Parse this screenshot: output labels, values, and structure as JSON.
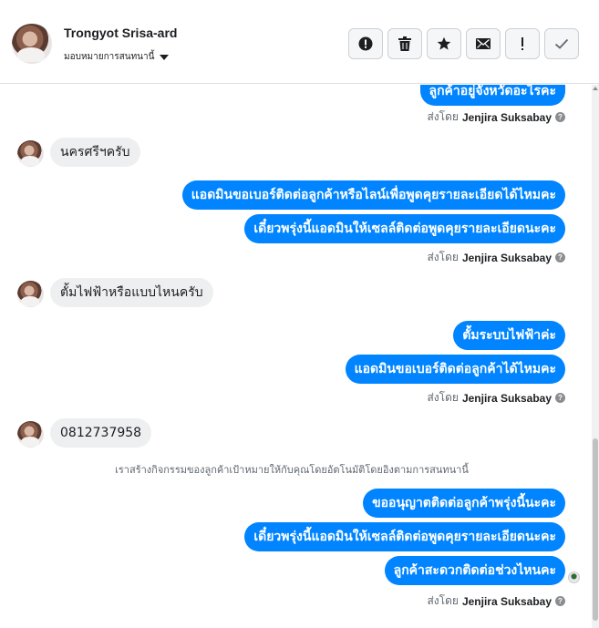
{
  "header": {
    "contact_name": "Trongyot Srisa-ard",
    "assign_label": "มอบหมายการสนทนานี้",
    "actions": [
      {
        "name": "spam-button",
        "icon": "alert-circle-icon"
      },
      {
        "name": "delete-button",
        "icon": "trash-icon"
      },
      {
        "name": "star-button",
        "icon": "star-icon"
      },
      {
        "name": "mark-unread-button",
        "icon": "envelope-icon"
      },
      {
        "name": "follow-up-button",
        "icon": "exclamation-icon"
      },
      {
        "name": "mark-done-button",
        "icon": "check-icon"
      }
    ]
  },
  "thread": {
    "messages": [
      {
        "dir": "out",
        "text": "ลูกค้าอยู่จังหวัดอะไรคะ"
      },
      {
        "dir": "sent_by",
        "prefix": "ส่งโดย",
        "agent": "Jenjira Suksabay"
      },
      {
        "dir": "in",
        "text": "นครศรีฯครับ"
      },
      {
        "dir": "out",
        "text": "แอดมินขอเบอร์ติดต่อลูกค้าหรือไลน์เพื่อพูดคุยรายละเอียดได้ไหมคะ"
      },
      {
        "dir": "out",
        "text": "เดี๋ยวพรุ่งนี้แอดมินให้เซลล์ติดต่อพูดคุยรายละเอียดนะคะ"
      },
      {
        "dir": "sent_by",
        "prefix": "ส่งโดย",
        "agent": "Jenjira Suksabay"
      },
      {
        "dir": "in",
        "text": "ตั้มไฟฟ้าหรือแบบไหนครับ"
      },
      {
        "dir": "out",
        "text": "ตั้มระบบไฟฟ้าค่ะ"
      },
      {
        "dir": "out",
        "text": "แอดมินขอเบอร์ติดต่อลูกค้าได้ไหมคะ"
      },
      {
        "dir": "sent_by",
        "prefix": "ส่งโดย",
        "agent": "Jenjira Suksabay"
      },
      {
        "dir": "in",
        "text": "0812737958"
      },
      {
        "dir": "system",
        "text": "เราสร้างกิจกรรมของลูกค้าเป้าหมายให้กับคุณโดยอัตโนมัติโดยอิงตามการสนทนานี้"
      },
      {
        "dir": "out",
        "text": "ขออนุญาตติดต่อลูกค้าพรุ่งนี้นะคะ"
      },
      {
        "dir": "out",
        "text": "เดี๋ยวพรุ่งนี้แอดมินให้เซลล์ติดต่อพูดคุยรายละเอียดนะคะ"
      },
      {
        "dir": "out",
        "text": "ลูกค้าสะดวกติดต่อช่วงไหนคะ"
      },
      {
        "dir": "sent_by",
        "prefix": "ส่งโดย",
        "agent": "Jenjira Suksabay"
      }
    ]
  },
  "colors": {
    "outgoing_bubble": "#0084ff",
    "incoming_bubble": "#eeeff1"
  }
}
